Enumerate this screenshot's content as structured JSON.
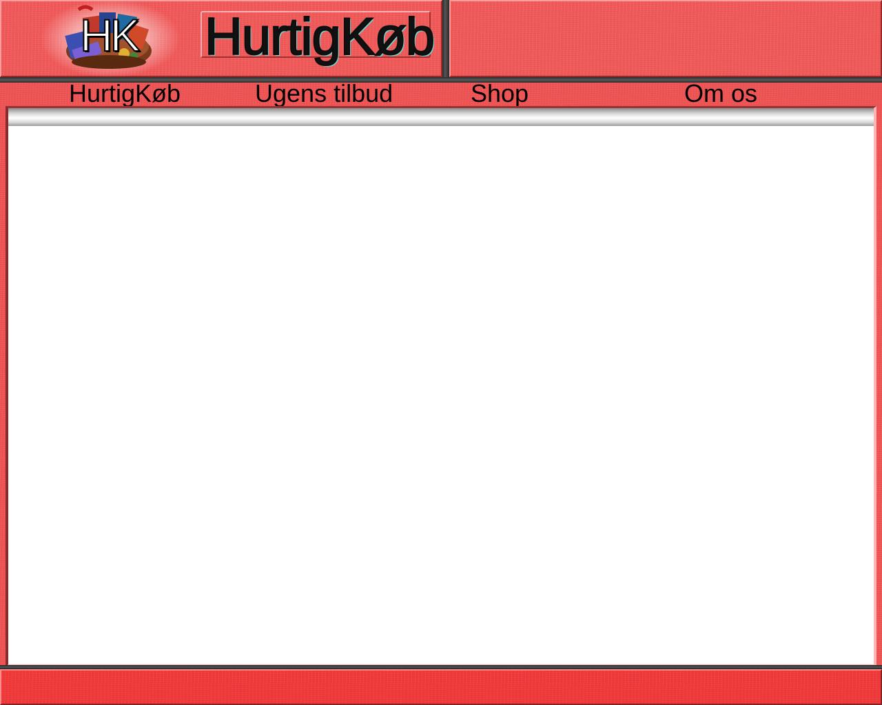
{
  "header": {
    "logo_text": "HK",
    "title": "HurtigKøb"
  },
  "nav": {
    "items": [
      {
        "label": "HurtigKøb"
      },
      {
        "label": "Ugens tilbud"
      },
      {
        "label": "Shop"
      },
      {
        "label": "Om os"
      }
    ]
  },
  "colors": {
    "background_red": "#f05454",
    "footer_red": "#f23a3a",
    "content_white": "#ffffff",
    "divider_dark": "#2b2b2b"
  },
  "icons": {
    "logo": "shopping-basket-logo-icon"
  }
}
